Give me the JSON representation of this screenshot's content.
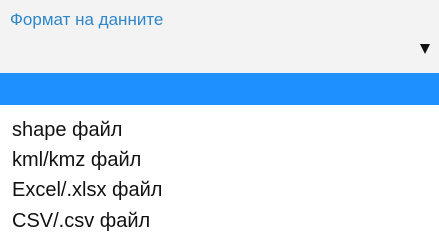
{
  "field": {
    "label": "Формат на данните",
    "selected_value": ""
  },
  "dropdown": {
    "options": [
      {
        "label": ""
      },
      {
        "label": "shape файл"
      },
      {
        "label": "kml/kmz файл"
      },
      {
        "label": "Excel/.xlsx файл"
      },
      {
        "label": "CSV/.csv файл"
      }
    ],
    "highlighted_index": 0
  },
  "colors": {
    "label": "#2f86c8",
    "highlight": "#1e90ff",
    "select_background": "#f3f3f3"
  },
  "icons": {
    "dropdown_arrow": "dropdown-arrow-icon"
  }
}
